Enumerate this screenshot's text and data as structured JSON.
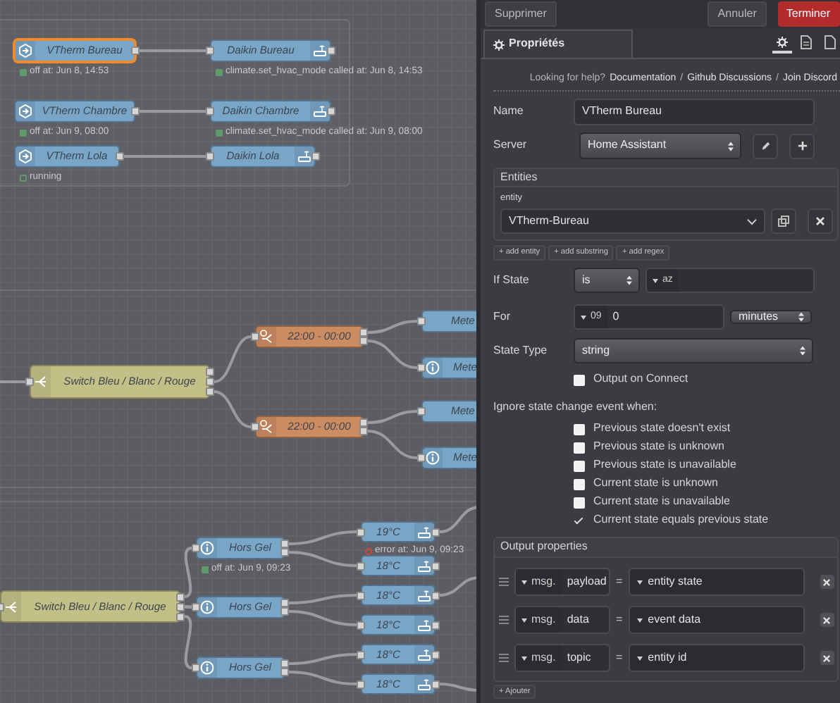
{
  "canvas": {
    "nodes": [
      {
        "label": "VTherm Bureau",
        "kind": "state",
        "selected": true,
        "status": {
          "text": "off at: Jun 8, 14:53",
          "kind": "dot"
        }
      },
      {
        "label": "Daikin Bureau",
        "kind": "action",
        "selected": false,
        "status": {
          "text": "climate.set_hvac_mode called at: Jun 8, 14:53",
          "kind": "dot"
        }
      },
      {
        "label": "VTherm Chambre",
        "kind": "state",
        "selected": false,
        "status": {
          "text": "off at: Jun 9, 08:00",
          "kind": "dot"
        }
      },
      {
        "label": "Daikin Chambre",
        "kind": "action",
        "selected": false,
        "status": {
          "text": "climate.set_hvac_mode called at: Jun 9, 08:00",
          "kind": "dot"
        }
      },
      {
        "label": "VTherm Lola",
        "kind": "state",
        "selected": false,
        "status": {
          "text": "running",
          "kind": "ring"
        }
      },
      {
        "label": "Daikin Lola",
        "kind": "action",
        "selected": false
      },
      {
        "label": "Switch Bleu / Blanc / Rouge",
        "kind": "switch",
        "selected": false
      },
      {
        "label": "22:00 - 00:00",
        "kind": "time",
        "selected": false
      },
      {
        "label": "22:00 - 00:00",
        "kind": "time",
        "selected": false
      },
      {
        "label": "Mete",
        "kind": "plain",
        "selected": false
      },
      {
        "label": "Mete",
        "kind": "info",
        "selected": false
      },
      {
        "label": "Mete",
        "kind": "plain",
        "selected": false
      },
      {
        "label": "Mete",
        "kind": "info",
        "selected": false
      },
      {
        "label": "Switch Bleu / Blanc / Rouge",
        "kind": "switch",
        "selected": false
      },
      {
        "label": "Hors Gel",
        "kind": "info",
        "selected": false,
        "status": {
          "text": "off at: Jun 9, 09:23",
          "kind": "dot"
        }
      },
      {
        "label": "Hors Gel",
        "kind": "info",
        "selected": false
      },
      {
        "label": "Hors Gel",
        "kind": "info",
        "selected": false
      },
      {
        "label": "19°C",
        "kind": "action",
        "selected": false,
        "status": {
          "text": "error at: Jun 9, 09:23",
          "kind": "error"
        }
      },
      {
        "label": "18°C",
        "kind": "action",
        "selected": false
      },
      {
        "label": "18°C",
        "kind": "action",
        "selected": false
      },
      {
        "label": "18°C",
        "kind": "action",
        "selected": false
      },
      {
        "label": "18°C",
        "kind": "action",
        "selected": false
      },
      {
        "label": "18°C",
        "kind": "action",
        "selected": false
      }
    ]
  },
  "toolbar": [
    {
      "label": "Supprimer",
      "kind": "default"
    },
    {
      "label": "Annuler",
      "kind": "default"
    },
    {
      "label": "Terminer",
      "kind": "primary"
    }
  ],
  "tabs": [
    {
      "label": "Propriétés",
      "selected": true
    }
  ],
  "tab_icons": [
    {
      "selected": true
    },
    {
      "selected": false
    },
    {
      "selected": false
    }
  ],
  "help": [
    {
      "text": "Looking for help?",
      "kind": "plain"
    },
    {
      "text": "Documentation",
      "kind": "link"
    },
    {
      "text": "/",
      "kind": "plain"
    },
    {
      "text": "Github Discussions",
      "kind": "link"
    },
    {
      "text": "/",
      "kind": "plain"
    },
    {
      "text": "Join Discord",
      "kind": "link"
    }
  ],
  "name": {
    "label": "Name",
    "value": "VTherm Bureau"
  },
  "server": {
    "label": "Server",
    "value": "Home Assistant"
  },
  "entities": {
    "title": "Entities",
    "field_label": "entity",
    "value": "VTherm-Bureau",
    "add_buttons": [
      "+ add entity",
      "+ add substring",
      "+ add regex"
    ]
  },
  "if_state": {
    "label": "If State",
    "operator": "is",
    "type_label": "az"
  },
  "for": {
    "label": "For",
    "type_label": "09",
    "value": "0",
    "unit": "minutes"
  },
  "state_type": {
    "label": "State Type",
    "value": "string"
  },
  "output_on_connect": {
    "label": "Output on Connect",
    "checked": false
  },
  "ignore": {
    "title": "Ignore state change event when:",
    "options": [
      {
        "label": "Previous state doesn't exist",
        "checked": false
      },
      {
        "label": "Previous state is unknown",
        "checked": false
      },
      {
        "label": "Previous state is unavailable",
        "checked": false
      },
      {
        "label": "Current state is unknown",
        "checked": false
      },
      {
        "label": "Current state is unavailable",
        "checked": false
      },
      {
        "label": "Current state equals previous state",
        "checked": true
      }
    ]
  },
  "output_properties": {
    "title": "Output properties",
    "rows": [
      {
        "prefix": "msg.",
        "property": "payload",
        "operator": "=",
        "value": "entity state"
      },
      {
        "prefix": "msg.",
        "property": "data",
        "operator": "=",
        "value": "event data"
      },
      {
        "prefix": "msg.",
        "property": "topic",
        "operator": "=",
        "value": "entity id"
      }
    ],
    "add_label": "+ Ajouter"
  }
}
